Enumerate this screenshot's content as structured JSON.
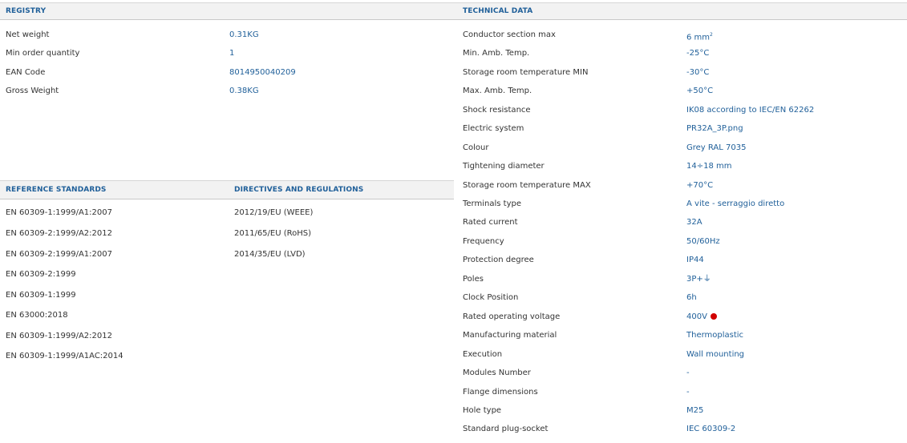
{
  "registry": {
    "title": "REGISTRY",
    "rows": [
      {
        "label": "Net weight",
        "value": "0.31KG"
      },
      {
        "label": "Min order quantity",
        "value": "1"
      },
      {
        "label": "EAN Code",
        "value": "8014950040209"
      },
      {
        "label": "Gross Weight",
        "value": "0.38KG"
      }
    ]
  },
  "reference_standards": {
    "title": "REFERENCE STANDARDS",
    "items": [
      "EN 60309-1:1999/A1:2007",
      "EN 60309-2:1999/A2:2012",
      "EN 60309-2:1999/A1:2007",
      "EN 60309-2:1999",
      "EN 60309-1:1999",
      "EN 63000:2018",
      "EN 60309-1:1999/A2:2012",
      "EN 60309-1:1999/A1AC:2014"
    ]
  },
  "directives": {
    "title": "DIRECTIVES AND REGULATIONS",
    "items": [
      "2012/19/EU (WEEE)",
      "2011/65/EU (RoHS)",
      "2014/35/EU (LVD)"
    ]
  },
  "technical": {
    "title": "TECHNICAL DATA",
    "rows": [
      {
        "label": "Conductor section max",
        "value": "6 mm²"
      },
      {
        "label": "Min. Amb. Temp.",
        "value": "-25°C"
      },
      {
        "label": "Storage room temperature MIN",
        "value": "-30°C"
      },
      {
        "label": "Max. Amb. Temp.",
        "value": "+50°C"
      },
      {
        "label": "Shock resistance",
        "value": "IK08 according to IEC/EN 62262"
      },
      {
        "label": "Electric system",
        "value": "PR32A_3P.png"
      },
      {
        "label": "Colour",
        "value": "Grey RAL 7035"
      },
      {
        "label": "Tightening diameter",
        "value": "14÷18 mm"
      },
      {
        "label": "Storage room temperature MAX",
        "value": "+70°C"
      },
      {
        "label": "Terminals type",
        "value": "A vite - serraggio diretto"
      },
      {
        "label": "Rated current",
        "value": "32A"
      },
      {
        "label": "Frequency",
        "value": "50/60Hz"
      },
      {
        "label": "Protection degree",
        "value": "IP44"
      },
      {
        "label": "Poles",
        "value": "3P+⏚"
      },
      {
        "label": "Clock Position",
        "value": "6h"
      },
      {
        "label": "Rated operating voltage",
        "value": "400V"
      },
      {
        "label": "Manufacturing material",
        "value": "Thermoplastic"
      },
      {
        "label": "Execution",
        "value": "Wall mounting"
      },
      {
        "label": "Modules Number",
        "value": "-"
      },
      {
        "label": "Flange dimensions",
        "value": "-"
      },
      {
        "label": "Hole type",
        "value": "M25"
      },
      {
        "label": "Standard plug-socket",
        "value": "IEC 60309-2"
      }
    ],
    "voltage_indicator_color": "#d10000"
  },
  "colors": {
    "accent": "#1f5f99",
    "header_bg": "#f2f2f2",
    "label": "#333333"
  }
}
